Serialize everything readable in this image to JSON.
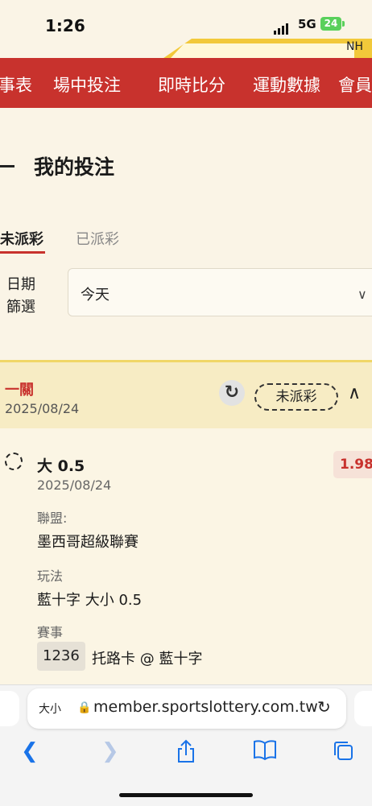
{
  "status_bar": {
    "time": "1:26",
    "network": "5G",
    "battery": "24"
  },
  "top_banner_text": "NH",
  "nav": {
    "items": [
      "事表",
      "場中投注",
      "即時比分",
      "運動數據",
      "會員"
    ]
  },
  "page": {
    "title": "我的投注"
  },
  "tabs": {
    "unsettled": "未派彩",
    "settled": "已派彩"
  },
  "date_filter": {
    "label": "日期篩選",
    "value": "今天"
  },
  "bet": {
    "type": "一關",
    "date": "2025/08/24",
    "status": "未派彩",
    "selection": "大 0.5",
    "selection_date": "2025/08/24",
    "odds": "1.98",
    "league_label": "聯盟:",
    "league": "墨西哥超級聯賽",
    "market_label": "玩法",
    "market": "藍十字 大小 0.5",
    "event_label": "賽事",
    "event_no": "1236",
    "event": "托路卡 @ 藍十字"
  },
  "browser": {
    "text_size": "大小",
    "url": "member.sportslottery.com.tw"
  },
  "colors": {
    "brand_red": "#c8322d",
    "accent_yellow": "#f2c93a",
    "background": "#faf4e6"
  }
}
